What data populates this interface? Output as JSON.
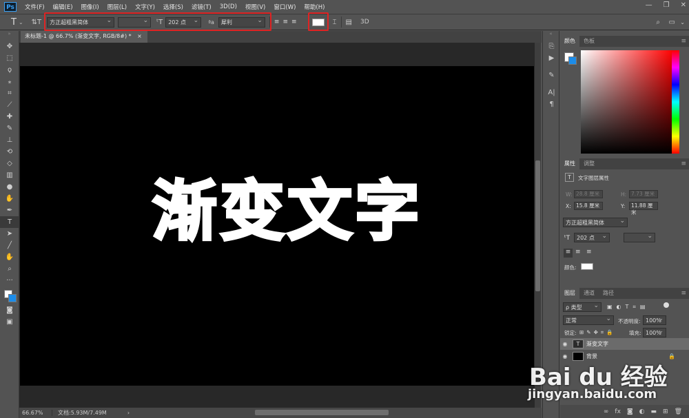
{
  "app": {
    "logo": "Ps"
  },
  "menu": [
    "文件(F)",
    "编辑(E)",
    "图像(I)",
    "图层(L)",
    "文字(Y)",
    "选择(S)",
    "滤镜(T)",
    "3D(D)",
    "视图(V)",
    "窗口(W)",
    "帮助(H)"
  ],
  "window_controls": {
    "minimize": "—",
    "restore": "❐",
    "close": "✕"
  },
  "options": {
    "tool_glyph": "T",
    "font_family": "方正超粗黑简体",
    "font_style": "",
    "font_size": "202 点",
    "aa_label": "ªa",
    "antialias": "犀利",
    "color_hex": "#ffffff",
    "three_d": "3D"
  },
  "document": {
    "tab_title": "未标题-1 @ 66.7% (渐变文字, RGB/8#) *",
    "canvas_text": "渐变文字",
    "zoom": "66.67%",
    "doc_info": "文档:5.93M/7.49M"
  },
  "panels": {
    "color": {
      "tabs": [
        "颜色",
        "色板"
      ]
    },
    "properties": {
      "tabs": [
        "属性",
        "调整"
      ],
      "subtitle": "文字图层属性",
      "w_label": "W:",
      "w_value": "28.8 厘米",
      "h_label": "H:",
      "h_value": "7.73 厘米",
      "x_label": "X:",
      "x_value": "15.8 厘米",
      "y_label": "Y:",
      "y_value": "11.88 厘米",
      "font_family": "方正超粗黑简体",
      "font_size": "202 点",
      "color_label": "颜色:"
    },
    "layers": {
      "tabs": [
        "图层",
        "通道",
        "路径"
      ],
      "filter_kind": "ρ 类型",
      "blend_mode": "正常",
      "opacity_label": "不透明度:",
      "opacity_value": "100%",
      "lock_label": "锁定:",
      "fill_label": "填充:",
      "fill_value": "100%",
      "rows": [
        {
          "name": "渐变文字",
          "thumb": "T"
        },
        {
          "name": "背景",
          "thumb": ""
        }
      ]
    }
  },
  "watermark": {
    "brand": "Bai du 经验",
    "url": "jingyan.baidu.com"
  }
}
